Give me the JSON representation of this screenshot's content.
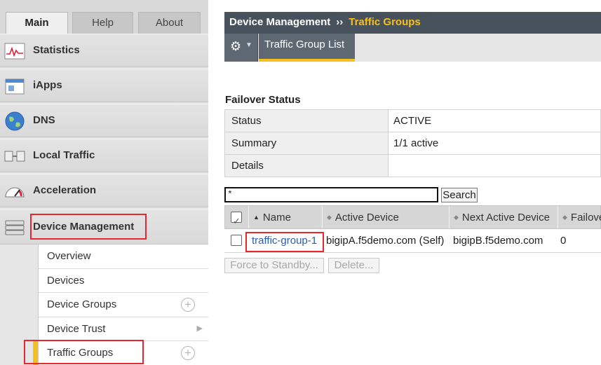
{
  "nav": {
    "tabs": [
      {
        "label": "Main",
        "active": true
      },
      {
        "label": "Help",
        "active": false
      },
      {
        "label": "About",
        "active": false
      }
    ],
    "sections": [
      {
        "label": "Statistics",
        "icon": "statistics-icon"
      },
      {
        "label": "iApps",
        "icon": "iapps-icon"
      },
      {
        "label": "DNS",
        "icon": "dns-globe-icon"
      },
      {
        "label": "Local Traffic",
        "icon": "local-traffic-icon"
      },
      {
        "label": "Acceleration",
        "icon": "acceleration-gauge-icon"
      },
      {
        "label": "Device Management",
        "icon": "device-management-icon",
        "expanded": true
      }
    ],
    "submenu": [
      {
        "label": "Overview",
        "indicator": ""
      },
      {
        "label": "Devices",
        "indicator": ""
      },
      {
        "label": "Device Groups",
        "indicator": "plus"
      },
      {
        "label": "Device Trust",
        "indicator": "arrow"
      },
      {
        "label": "Traffic Groups",
        "indicator": "plus",
        "selected": true
      }
    ]
  },
  "breadcrumb": {
    "parent": "Device Management",
    "separator": "››",
    "current": "Traffic Groups"
  },
  "toolbar": {
    "gear_icon": "gear-icon",
    "tab_label": "Traffic Group List"
  },
  "failover": {
    "title": "Failover Status",
    "rows": [
      {
        "key": "Status",
        "value": "ACTIVE"
      },
      {
        "key": "Summary",
        "value": "1/1 active"
      },
      {
        "key": "Details",
        "value": ""
      }
    ]
  },
  "search": {
    "value": "*",
    "button_label": "Search"
  },
  "table": {
    "columns": [
      "Name",
      "Active Device",
      "Next Active Device",
      "Failove"
    ],
    "rows": [
      {
        "name": "traffic-group-1",
        "active_device": "bigipA.f5demo.com (Self)",
        "next_active_device": "bigipB.f5demo.com",
        "failover": "0"
      }
    ]
  },
  "actions": {
    "force_standby": "Force to Standby...",
    "delete": "Delete..."
  },
  "colors": {
    "accent": "#f5c01e",
    "highlight": "#e8262b",
    "header_bg": "#48525d",
    "link": "#2a5db0"
  }
}
